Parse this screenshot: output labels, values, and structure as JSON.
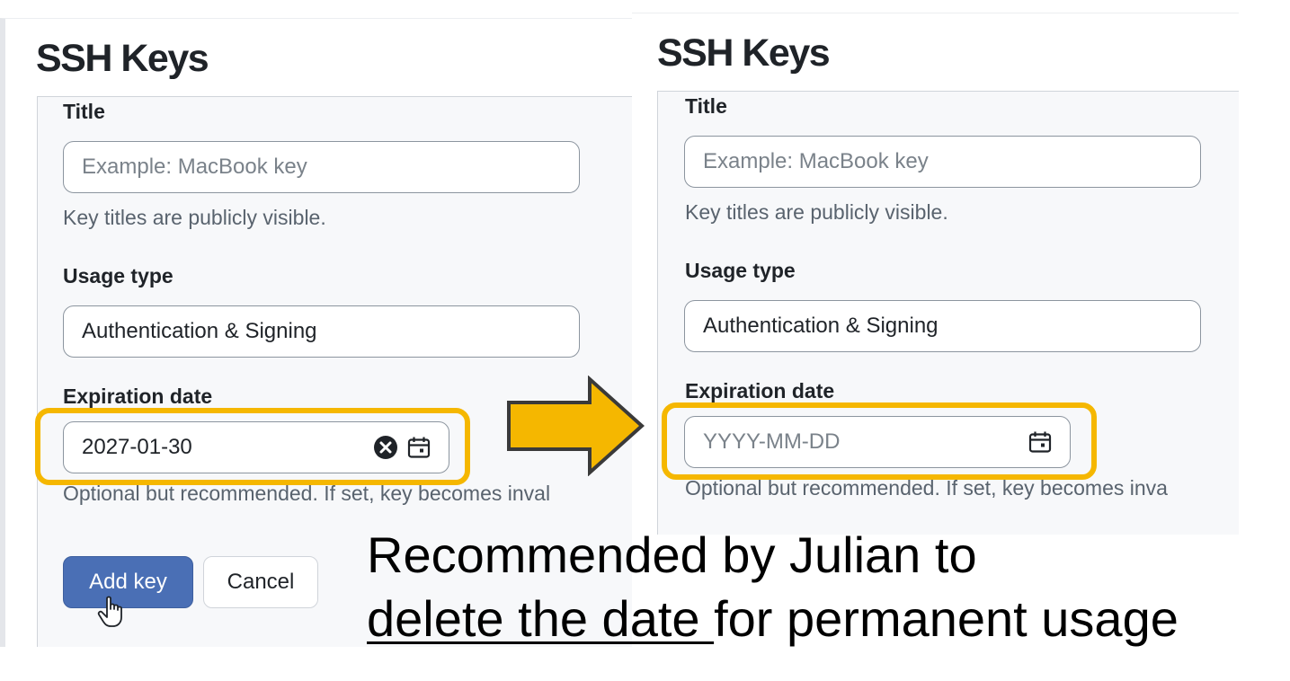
{
  "colors": {
    "highlight": "#f5b700",
    "primary_button": "#4a6fb5",
    "arrow_fill": "#f5b700",
    "arrow_stroke": "#3a3a3a"
  },
  "before": {
    "page_title": "SSH Keys",
    "title_label": "Title",
    "title_placeholder": "Example: MacBook key",
    "title_hint": "Key titles are publicly visible.",
    "usage_label": "Usage type",
    "usage_value": "Authentication & Signing",
    "expiration_label": "Expiration date",
    "expiration_value": "2027-01-30",
    "expiration_hint": "Optional but recommended. If set, key becomes inval",
    "add_key_label": "Add key",
    "cancel_label": "Cancel"
  },
  "after": {
    "page_title": "SSH Keys",
    "title_label": "Title",
    "title_placeholder": "Example: MacBook key",
    "title_hint": "Key titles are publicly visible.",
    "usage_label": "Usage type",
    "usage_value": "Authentication & Signing",
    "expiration_label": "Expiration date",
    "expiration_placeholder": "YYYY-MM-DD",
    "expiration_hint": "Optional but recommended. If set, key becomes inva"
  },
  "caption": {
    "line1": "Recommended by Julian to",
    "line2_underlined": "delete the date ",
    "line2_rest": "for permanent usage"
  },
  "icons": {
    "clear": "clear-icon",
    "calendar": "calendar-icon",
    "cursor": "hand-cursor-icon",
    "arrow": "right-arrow-icon"
  }
}
